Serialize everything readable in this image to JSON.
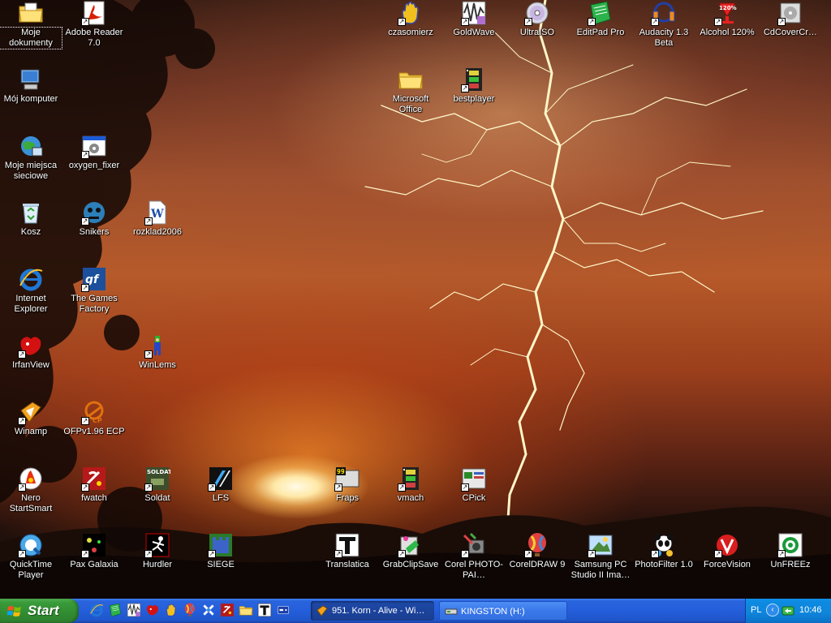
{
  "desktop": {
    "icons": [
      {
        "label": "Moje dokumenty",
        "icon": "folder-documents-icon",
        "selected": true
      },
      {
        "label": "Adobe Reader 7.0",
        "icon": "adobe-reader-icon"
      },
      {
        "label": "Mój komputer",
        "icon": "my-computer-icon"
      },
      {
        "label": "Moje miejsca sieciowe",
        "icon": "network-places-icon"
      },
      {
        "label": "oxygen_fixer",
        "icon": "app-window-icon"
      },
      {
        "label": "Kosz",
        "icon": "recycle-bin-icon"
      },
      {
        "label": "Snikers",
        "icon": "face-icon"
      },
      {
        "label": "rozklad2006",
        "icon": "word-document-icon"
      },
      {
        "label": "Internet Explorer",
        "icon": "internet-explorer-icon"
      },
      {
        "label": "The Games Factory",
        "icon": "games-factory-icon"
      },
      {
        "label": "IrfanView",
        "icon": "irfanview-icon"
      },
      {
        "label": "WinLems",
        "icon": "lemming-icon"
      },
      {
        "label": "Winamp",
        "icon": "winamp-icon"
      },
      {
        "label": "OFPv1.96 ECP",
        "icon": "ofp-icon"
      },
      {
        "label": "Nero StartSmart",
        "icon": "nero-icon"
      },
      {
        "label": "fwatch",
        "icon": "fwatch-icon"
      },
      {
        "label": "Soldat",
        "icon": "soldat-icon"
      },
      {
        "label": "LFS",
        "icon": "lfs-icon"
      },
      {
        "label": "Fraps",
        "icon": "fraps-icon"
      },
      {
        "label": "vmach",
        "icon": "film-icon"
      },
      {
        "label": "CPick",
        "icon": "cpick-icon"
      },
      {
        "label": "QuickTime Player",
        "icon": "quicktime-icon"
      },
      {
        "label": "Pax Galaxia",
        "icon": "galaxy-icon"
      },
      {
        "label": "Hurdler",
        "icon": "hurdler-icon"
      },
      {
        "label": "SIEGE",
        "icon": "siege-icon"
      },
      {
        "label": "Translatica",
        "icon": "translatica-icon"
      },
      {
        "label": "GrabClipSave",
        "icon": "grabclip-icon"
      },
      {
        "label": "Corel PHOTO-PAI…",
        "icon": "corel-photopaint-icon"
      },
      {
        "label": "CorelDRAW 9",
        "icon": "balloon-icon"
      },
      {
        "label": "Samsung PC Studio II Ima…",
        "icon": "samsung-studio-icon"
      },
      {
        "label": "PhotoFilter 1.0",
        "icon": "panda-icon"
      },
      {
        "label": "ForceVision",
        "icon": "forcevision-icon"
      },
      {
        "label": "UnFREEz",
        "icon": "unfreez-icon"
      },
      {
        "label": "czasomierz",
        "icon": "hand-icon"
      },
      {
        "label": "GoldWave",
        "icon": "goldwave-icon"
      },
      {
        "label": "UltraISO",
        "icon": "cd-icon"
      },
      {
        "label": "EditPad Pro",
        "icon": "notepad-icon"
      },
      {
        "label": "Audacity 1.3 Beta",
        "icon": "audacity-icon"
      },
      {
        "label": "Alcohol 120%",
        "icon": "alcohol-icon"
      },
      {
        "label": "CdCoverCr…",
        "icon": "cdcover-icon"
      },
      {
        "label": "Microsoft Office",
        "icon": "folder-icon"
      },
      {
        "label": "bestplayer",
        "icon": "film-icon"
      }
    ]
  },
  "taskbar": {
    "start_label": "Start",
    "quicklaunch": [
      "internet-explorer-icon",
      "editpad-icon",
      "goldwave-icon",
      "irfanview-icon",
      "hand-icon",
      "balloon-icon",
      "cross-icon",
      "fwatch-icon",
      "folder-icon",
      "translatica-icon",
      "game-icon"
    ],
    "tasks": [
      {
        "label": "951. Korn - Alive - Wi…",
        "icon": "winamp-icon",
        "active": true
      },
      {
        "label": "KINGSTON (H:)",
        "icon": "drive-icon",
        "active": false
      }
    ],
    "tray": {
      "language": "PL",
      "clock": "10:46"
    }
  }
}
